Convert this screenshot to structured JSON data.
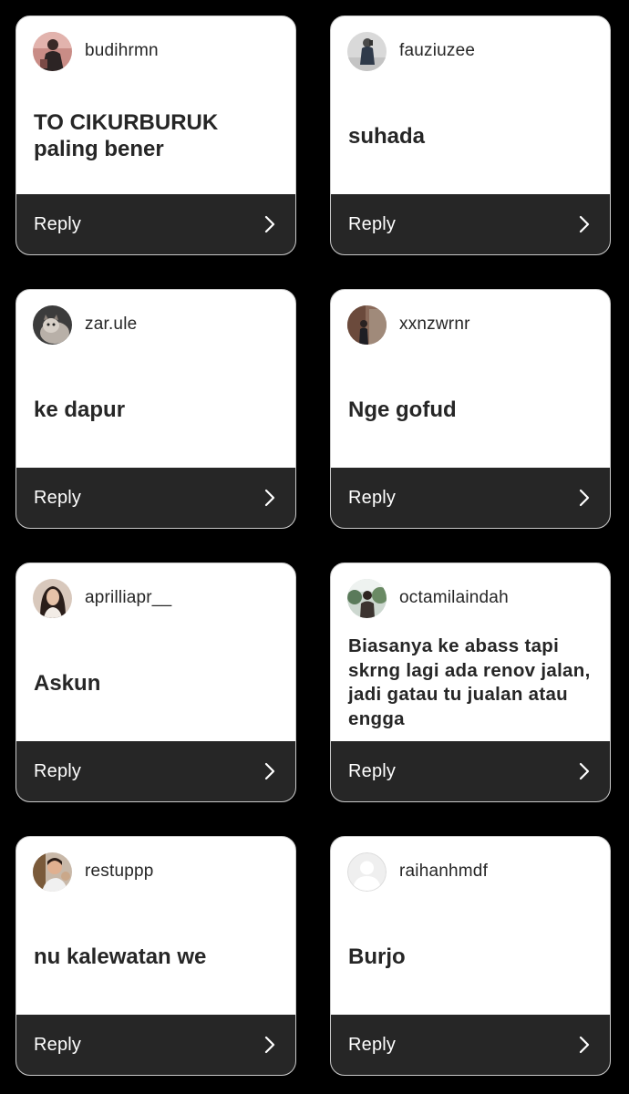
{
  "reply_label": "Reply",
  "cards": [
    {
      "username": "budihrmn",
      "message": "TO CIKURBURUK paling bener",
      "avatar": "user-photo"
    },
    {
      "username": "fauziuzee",
      "message": "suhada",
      "avatar": "user-photo"
    },
    {
      "username": "zar.ule",
      "message": "ke dapur",
      "avatar": "cat-photo"
    },
    {
      "username": "xxnzwrnr",
      "message": "Nge gofud",
      "avatar": "user-photo"
    },
    {
      "username": "aprilliapr__",
      "message": "Askun",
      "avatar": "user-photo"
    },
    {
      "username": "octamilaindah",
      "message": "Biasanya ke abass tapi skrng lagi ada renov jalan, jadi gatau tu jualan atau engga",
      "avatar": "user-photo"
    },
    {
      "username": "restuppp",
      "message": "nu kalewatan we",
      "avatar": "user-photo"
    },
    {
      "username": "raihanhmdf",
      "message": "Burjo",
      "avatar": "default-avatar"
    }
  ],
  "colors": {
    "page_background": "#000000",
    "card_background": "#ffffff",
    "reply_bar": "#262626",
    "text": "#262626"
  }
}
